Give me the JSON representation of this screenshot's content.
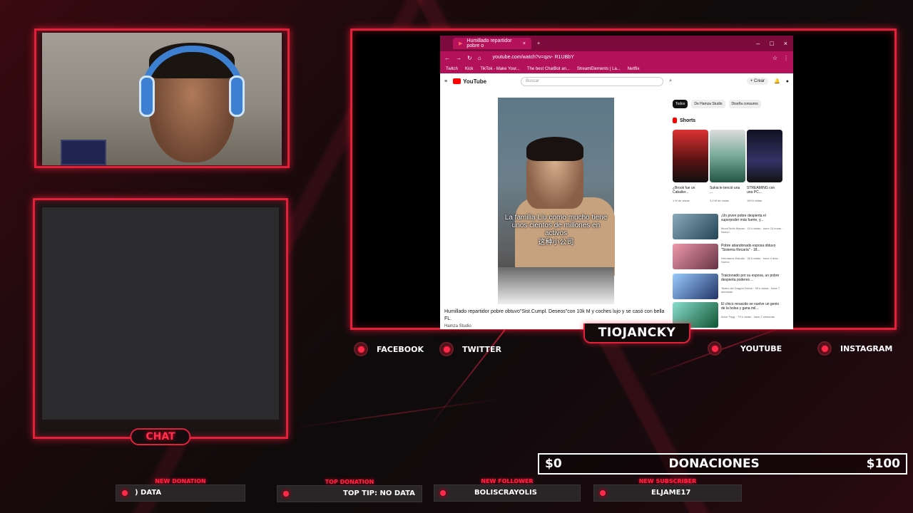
{
  "browser": {
    "tab_title": "Humillado repartidor pobre o",
    "url": "youtube.com/watch?v=qzv- R1UBbY",
    "bookmarks": [
      "Twitch",
      "Kick",
      "TikTok - Make Your...",
      "The best ChatBot an...",
      "StreamElements | La...",
      "Netflix"
    ]
  },
  "youtube": {
    "logo": "YouTube",
    "search_placeholder": "Buscar",
    "create_label": "Crear",
    "subtitle_es": "La familia Liu como mucho tiene unos cientos de millones en activos",
    "subtitle_zh": "这种小公司",
    "video_title": "Humillado repartidor pobre obtuvo\"Sist.Cumpl. Deseos\"con 10k M y coches lujo y se casó con bella FL.",
    "channel": "Hamza Studio",
    "chips": [
      "Todos",
      "De Hamza Studio",
      "Diseña consumo"
    ],
    "shorts_header": "Shorts",
    "shorts": [
      {
        "title": "¿Brook fue un Caballer...",
        "views": "1 M de vistas"
      },
      {
        "title": "Sukia le tenció una ...",
        "views": "3,4 M de vistas"
      },
      {
        "title": "STREAMING con una PC...",
        "views": "159 k vistas"
      }
    ],
    "recommended": [
      {
        "title": "¡Un joven pobre despierta el superpoder más fuerte, y...",
        "meta": "MoonTooth Macao · 10 k vistas · hace 13 horas · Nuevo"
      },
      {
        "title": "Pobre abandonado esposa obtuvo \"Sistema Recaría\" - 18...",
        "meta": "Hermanos Estudio · 26 k vistas · hace 4 días · Nuevo"
      },
      {
        "title": "Traicionado por su esposa, un pobre despierta poderes ...",
        "meta": "Teatro del Dragón Divino · 99 k vistas · hace 7 semanas"
      },
      {
        "title": "El chico renacido se vuelve un genio de la bolsa y gana mil...",
        "meta": "Amor Fagy · 79 k vistas · hace 2 semanas"
      }
    ]
  },
  "overlay": {
    "streamer_name": "TIOJANCKY",
    "chat_label": "CHAT",
    "socials": [
      {
        "name": "FACEBOOK"
      },
      {
        "name": "TWITTER"
      },
      {
        "name": "YOUTUBE"
      },
      {
        "name": "INSTAGRAM"
      }
    ],
    "donation_goal": {
      "current": "$0",
      "label": "DONACIONES",
      "target": "$100"
    },
    "alerts": [
      {
        "label": "NEW DONATION",
        "value": ") DATA"
      },
      {
        "label": "TOP DONATION",
        "value": "TOP TIP: NO DATA"
      },
      {
        "label": "NEW FOLLOWER",
        "value": "BOLISCRAYOLIS"
      },
      {
        "label": "NEW SUBSCRIBER",
        "value": "ELJAME17"
      }
    ]
  },
  "colors": {
    "accent": "#e2203a",
    "browser_bar": "#b3125b",
    "youtube_red": "#ff0000"
  }
}
